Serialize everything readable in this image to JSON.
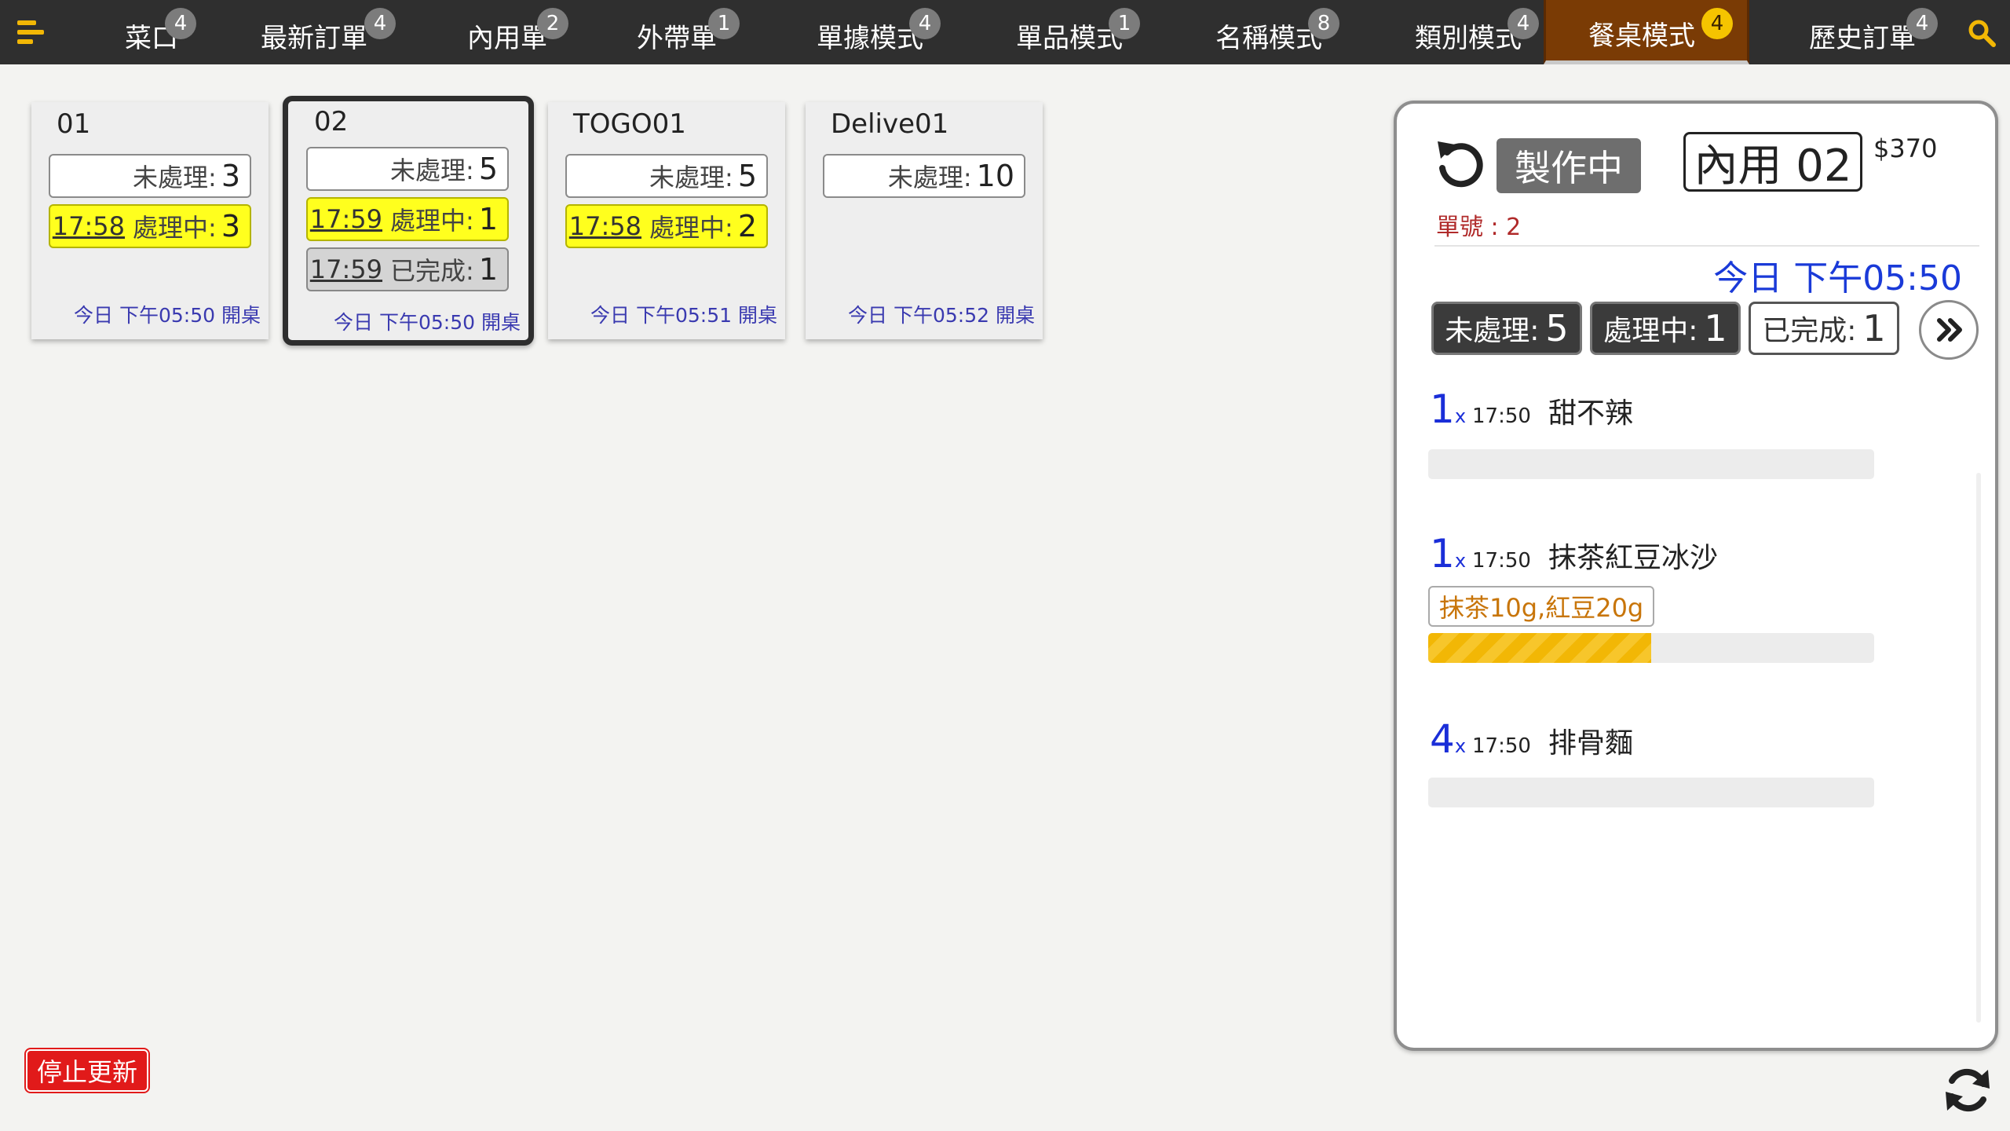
{
  "nav": {
    "menu_icon": "hamburger-icon",
    "tabs": [
      {
        "label": "菜口",
        "count": "4"
      },
      {
        "label": "最新訂單",
        "count": "4"
      },
      {
        "label": "內用單",
        "count": "2"
      },
      {
        "label": "外帶單",
        "count": "1"
      },
      {
        "label": "單據模式",
        "count": "4"
      },
      {
        "label": "單品模式",
        "count": "1"
      },
      {
        "label": "名稱模式",
        "count": "8"
      },
      {
        "label": "類別模式",
        "count": "4"
      },
      {
        "label": "餐桌模式",
        "count": "4"
      },
      {
        "label": "歷史訂單",
        "count": "4"
      }
    ],
    "active_tab": "餐桌模式",
    "search_icon": "search-icon",
    "colors": {
      "bar": "#2f2f2f",
      "active": "#7a3b05",
      "accent": "#f2b705"
    }
  },
  "tables": [
    {
      "name": "01",
      "pending_label": "未處理:",
      "pending": "3",
      "processing_time": "17:58",
      "processing_label": "處理中:",
      "processing": "3",
      "opened": "今日 下午05:50 開桌"
    },
    {
      "name": "02",
      "pending_label": "未處理:",
      "pending": "5",
      "processing_time": "17:59",
      "processing_label": "處理中:",
      "processing": "1",
      "done_time": "17:59",
      "done_label": "已完成:",
      "done": "1",
      "opened": "今日 下午05:50 開桌"
    },
    {
      "name": "TOGO01",
      "pending_label": "未處理:",
      "pending": "5",
      "processing_time": "17:58",
      "processing_label": "處理中:",
      "processing": "2",
      "opened": "今日 下午05:51 開桌"
    },
    {
      "name": "Delive01",
      "pending_label": "未處理:",
      "pending": "10",
      "opened": "今日 下午05:52 開桌"
    }
  ],
  "detail": {
    "status": "製作中",
    "table": "內用 02",
    "total": "$370",
    "order_no": "單號 : 2",
    "time": "今日 下午05:50",
    "stats": {
      "pending_label": "未處理:",
      "pending": "5",
      "processing_label": "處理中:",
      "processing": "1",
      "done_label": "已完成:",
      "done": "1"
    },
    "items": [
      {
        "qty": "1",
        "x": "x",
        "time": "17:50",
        "name": "甜不辣",
        "progress": 0
      },
      {
        "qty": "1",
        "x": "x",
        "time": "17:50",
        "name": "抹茶紅豆冰沙",
        "modifier": "抹茶10g,紅豆20g",
        "progress": 0.5
      },
      {
        "qty": "4",
        "x": "x",
        "time": "17:50",
        "name": "排骨麵",
        "progress": 0
      }
    ]
  },
  "footer": {
    "stop_label": "停止更新",
    "refresh_icon": "refresh-icon"
  }
}
